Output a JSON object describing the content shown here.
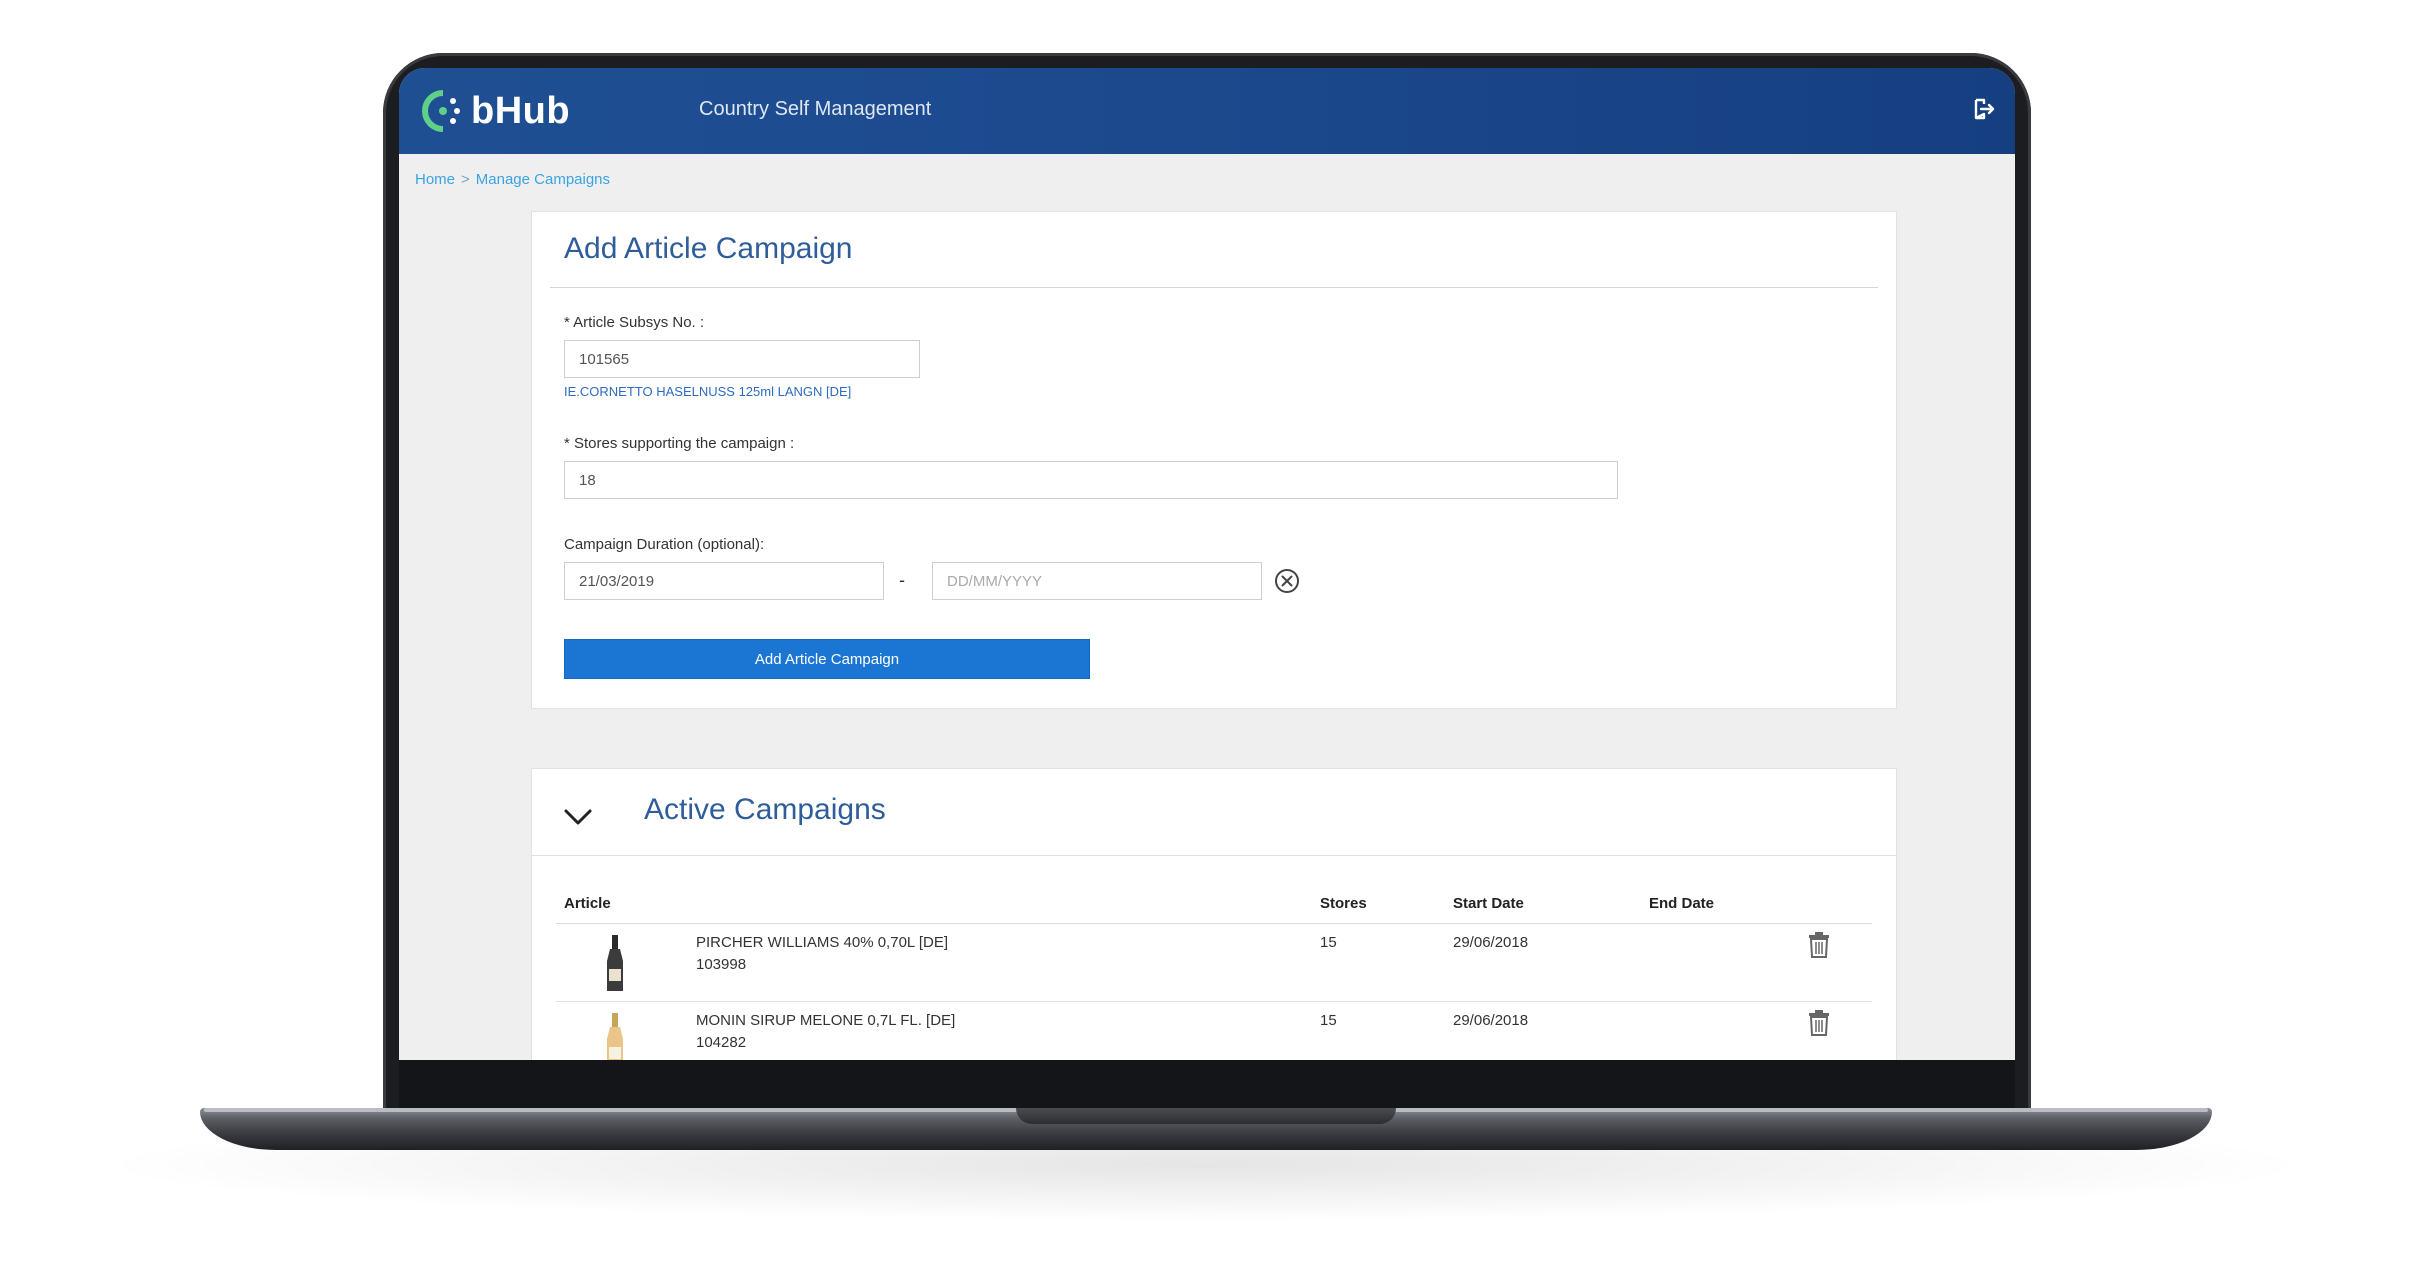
{
  "header": {
    "logo_text": "bHub",
    "logo_brand_color": "#5fd08a",
    "title": "Country Self Management",
    "background_color": "#1f4f93"
  },
  "breadcrumb": {
    "home": "Home",
    "separator": ">",
    "current": "Manage Campaigns"
  },
  "add_campaign": {
    "title": "Add Article Campaign",
    "article_label": "* Article Subsys No. :",
    "article_value": "101565",
    "article_description": "IE.CORNETTO HASELNUSS 125ml LANGN [DE]",
    "stores_label": "* Stores supporting the campaign :",
    "stores_value": "18",
    "duration_label": "Campaign Duration (optional):",
    "start_date_value": "21/03/2019",
    "date_separator": "-",
    "end_date_placeholder": "DD/MM/YYYY",
    "submit_label": "Add Article Campaign",
    "accent_color": "#1b76d3"
  },
  "active_campaigns": {
    "title": "Active Campaigns",
    "columns": {
      "article": "Article",
      "stores": "Stores",
      "start_date": "Start Date",
      "end_date": "End Date"
    },
    "rows": [
      {
        "name": "PIRCHER WILLIAMS 40% 0,70L [DE]",
        "id": "103998",
        "stores": "15",
        "start_date": "29/06/2018",
        "end_date": "",
        "image_icon": "bottle-dark-icon"
      },
      {
        "name": "MONIN SIRUP MELONE 0,7L FL. [DE]",
        "id": "104282",
        "stores": "15",
        "start_date": "29/06/2018",
        "end_date": "",
        "image_icon": "bottle-amber-icon"
      }
    ]
  }
}
